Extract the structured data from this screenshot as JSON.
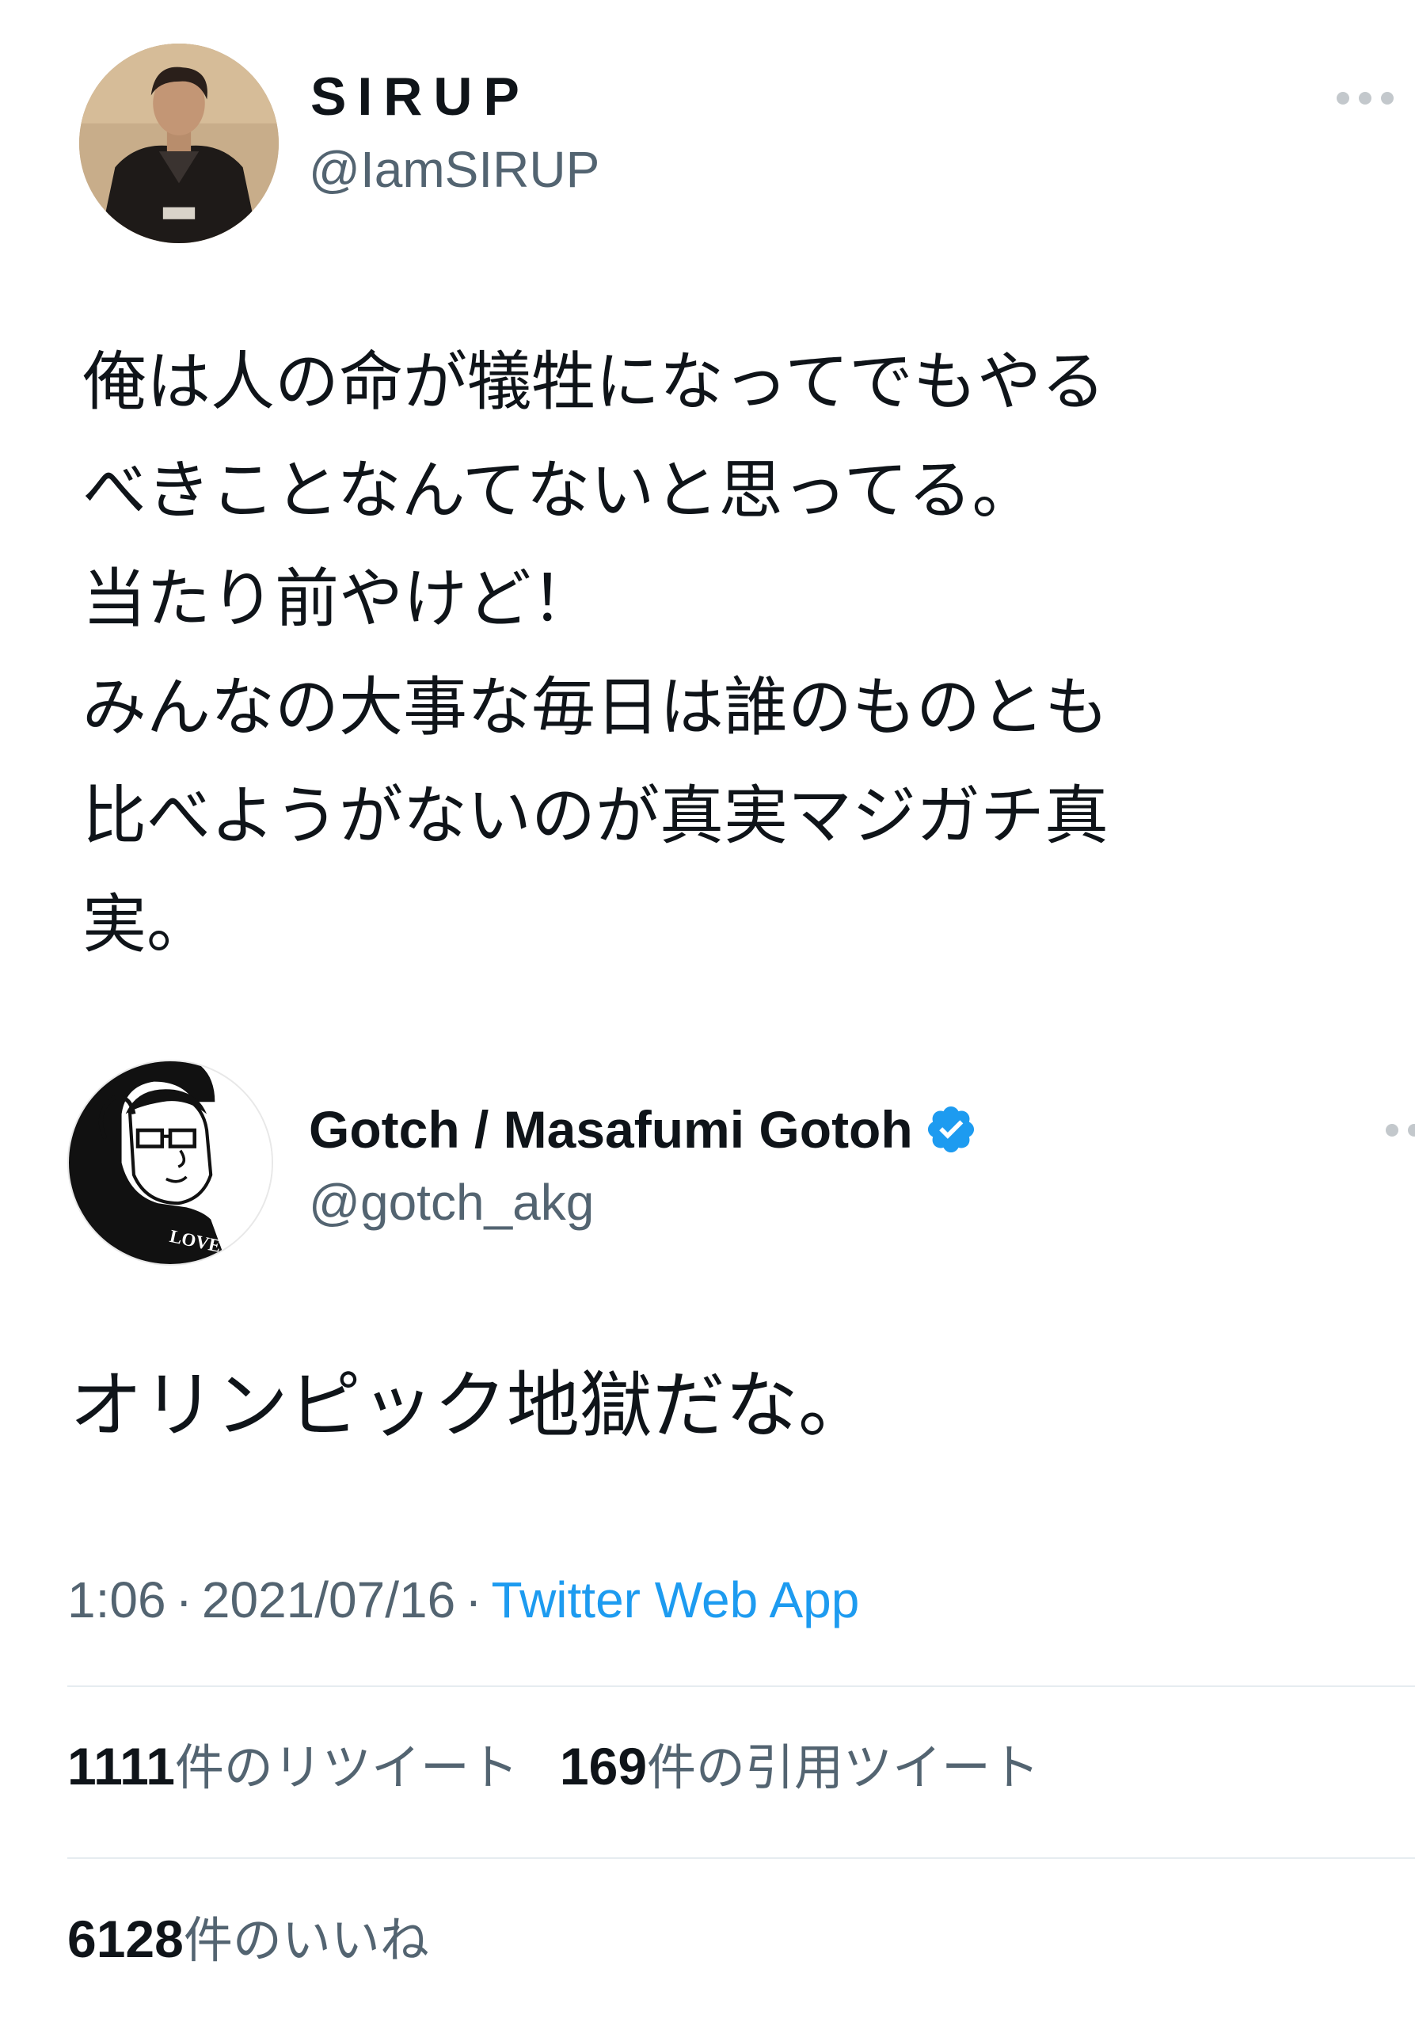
{
  "tweet": {
    "author": {
      "display_name": "SIRUP",
      "handle": "@IamSIRUP",
      "avatar_icon": "avatar-photo"
    },
    "text": "俺は人の命が犠牲になってでもやる\nべきことなんてないと思ってる。\n当たり前やけど！\nみんなの大事な毎日は誰のものとも\n比べようがないのが真実マジガチ真\n実。",
    "more_icon": "more-horizontal-icon"
  },
  "quoted_tweet": {
    "author": {
      "display_name": "Gotch / Masafumi Gotoh",
      "handle": "@gotch_akg",
      "verified": true,
      "avatar_icon": "avatar-illustration",
      "avatar_text": "LOVE"
    },
    "text": "オリンピック地獄だな。",
    "time": "1:06",
    "separator": "·",
    "date": "2021/07/16",
    "source_app": "Twitter Web App",
    "more_icon": "more-horizontal-icon"
  },
  "stats": {
    "retweets_count": "1111",
    "retweets_label": "件のリツイート",
    "quotes_count": "169",
    "quotes_label": "件の引用ツイート",
    "likes_count": "6128",
    "likes_label": "件のいいね"
  },
  "colors": {
    "text_primary": "#0f1419",
    "text_secondary": "#536471",
    "link": "#1d9bf0",
    "verified": "#1d9bf0",
    "divider": "#e6ecf0"
  }
}
